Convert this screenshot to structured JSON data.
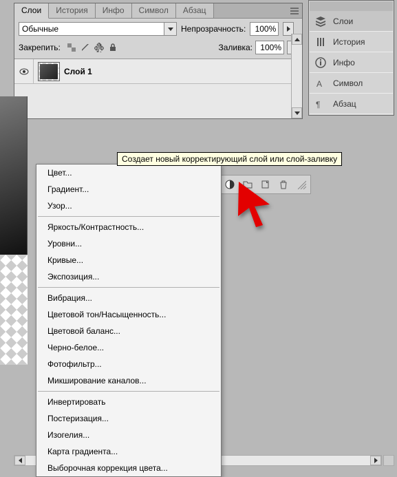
{
  "tabs": {
    "layers": "Слои",
    "history": "История",
    "info": "Инфо",
    "symbol": "Символ",
    "paragraph": "Абзац"
  },
  "blend_mode": {
    "selected": "Обычные"
  },
  "opacity": {
    "label": "Непрозрачность:",
    "value": "100%"
  },
  "lock": {
    "label": "Закрепить:"
  },
  "fill": {
    "label": "Заливка:",
    "value": "100%"
  },
  "layer": {
    "name": "Слой 1"
  },
  "right_panel": {
    "layers": "Слои",
    "history": "История",
    "info": "Инфо",
    "symbol": "Символ",
    "paragraph": "Абзац"
  },
  "tooltip": "Создает новый корректирующий слой или слой-заливку",
  "menu": {
    "color": "Цвет...",
    "gradient": "Градиент...",
    "pattern": "Узор...",
    "brightness": "Яркость/Контрастность...",
    "levels": "Уровни...",
    "curves": "Кривые...",
    "exposure": "Экспозиция...",
    "vibrance": "Вибрация...",
    "hue": "Цветовой тон/Насыщенность...",
    "balance": "Цветовой баланс...",
    "bw": "Черно-белое...",
    "photofilter": "Фотофильтр...",
    "mixer": "Микширование каналов...",
    "invert": "Инвертировать",
    "posterize": "Постеризация...",
    "threshold": "Изогелия...",
    "gradmap": "Карта градиента...",
    "selective": "Выборочная коррекция цвета..."
  }
}
